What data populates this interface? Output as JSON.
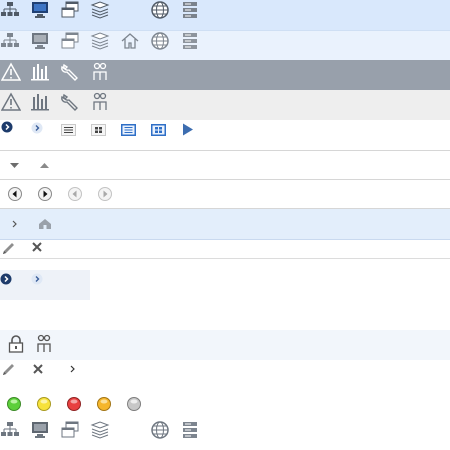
{
  "colors": {
    "toolbar_blue": "#d9e8fc",
    "toolbar_blue_light": "#eaf2fd",
    "toolbar_gray_dark": "#98a0ab",
    "toolbar_gray_light": "#eeeeee",
    "breadcrumb_bg": "#e3eefb",
    "panel_bg": "#eef2f8",
    "lock_bar_bg": "#f2f6fb",
    "icon_dark": "#505a66",
    "icon_light": "#ffffff",
    "accent_blue": "#2e6fc7",
    "status_green": "#5ccf3a",
    "status_yellow": "#f7e23b",
    "status_red": "#e84040",
    "status_orange": "#f5b62b",
    "status_gray": "#c7c7c7"
  },
  "toolbars": {
    "network": [
      "network-icon",
      "monitor-icon",
      "windows-icon",
      "stack-icon",
      "globe-icon",
      "server-icon"
    ],
    "network_home": [
      "network-icon",
      "monitor-icon",
      "windows-icon",
      "stack-icon",
      "home-icon",
      "globe-icon",
      "server-icon"
    ],
    "admin": [
      "warning-icon",
      "bar-chart-icon",
      "wrench-icon",
      "users-icon"
    ]
  },
  "status_lights": [
    "green",
    "yellow",
    "red",
    "orange",
    "gray"
  ]
}
